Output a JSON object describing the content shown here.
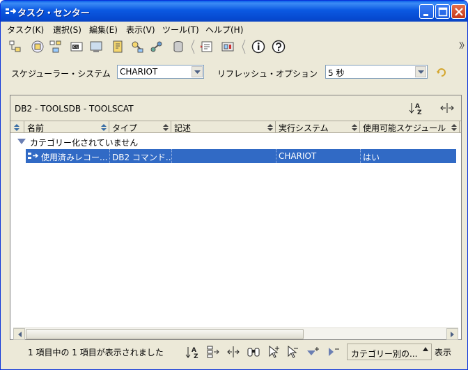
{
  "window": {
    "title": "タスク・センター"
  },
  "menu": [
    "タスク(K)",
    "選択(S)",
    "編集(E)",
    "表示(V)",
    "ツール(T)",
    "ヘルプ(H)"
  ],
  "toolbar": {
    "icons": [
      "control-center-icon",
      "replication-center-icon",
      "satellite-admin-icon",
      "command-center-icon",
      "task-center-icon",
      "journal-icon",
      "license-center-icon",
      "development-center-icon",
      "data-warehouse-icon",
      "information-catalog-icon",
      "health-center-icon",
      "info-icon",
      "help-icon"
    ]
  },
  "options": {
    "scheduler_label": "スケジューラー・システム",
    "scheduler_value": "CHARIOT",
    "refresh_label": "リフレッシュ・オプション",
    "refresh_value": "5 秒"
  },
  "panel": {
    "title": "DB2 - TOOLSDB - TOOLSCAT",
    "columns": [
      "名前",
      "タイプ",
      "記述",
      "実行システム",
      "使用可能スケジュール"
    ],
    "group_label": "カテゴリー化されていません",
    "rows": [
      {
        "name": "使用済みレコー...",
        "type": "DB2 コマンド...",
        "description": "",
        "run_system": "CHARIOT",
        "schedule": "はい"
      }
    ]
  },
  "status": {
    "text": "1 項目中の 1 項目が表示されました",
    "category_button": "カテゴリー別の...",
    "view_label": "表示"
  },
  "colors": {
    "titlebar": "#0a59e2",
    "selection": "#316ac5",
    "window_bg": "#ece9d8"
  }
}
